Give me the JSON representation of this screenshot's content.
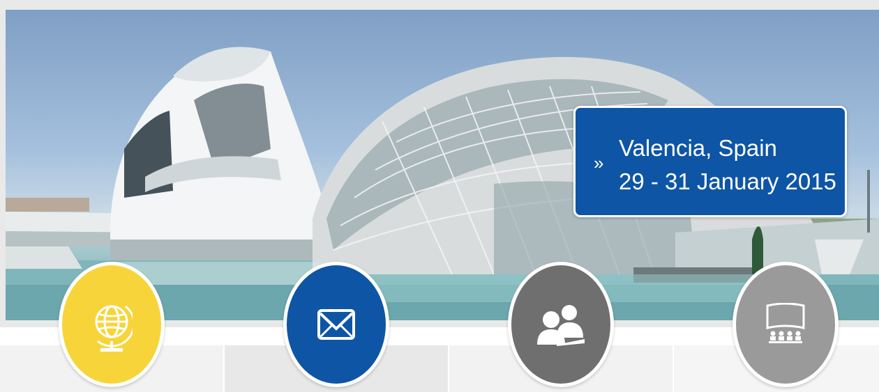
{
  "location": {
    "chevron": "»",
    "city": "Valencia, Spain",
    "dates": "29 - 31 January 2015"
  },
  "colors": {
    "card_blue": "#0e55a6",
    "globe_yellow": "#f7d53a",
    "people_gray": "#6f6f6f",
    "screen_gray": "#9a9a9a"
  },
  "features": [
    {
      "icon": "globe-icon"
    },
    {
      "icon": "envelope-icon"
    },
    {
      "icon": "people-icon"
    },
    {
      "icon": "presentation-screen-icon"
    }
  ]
}
